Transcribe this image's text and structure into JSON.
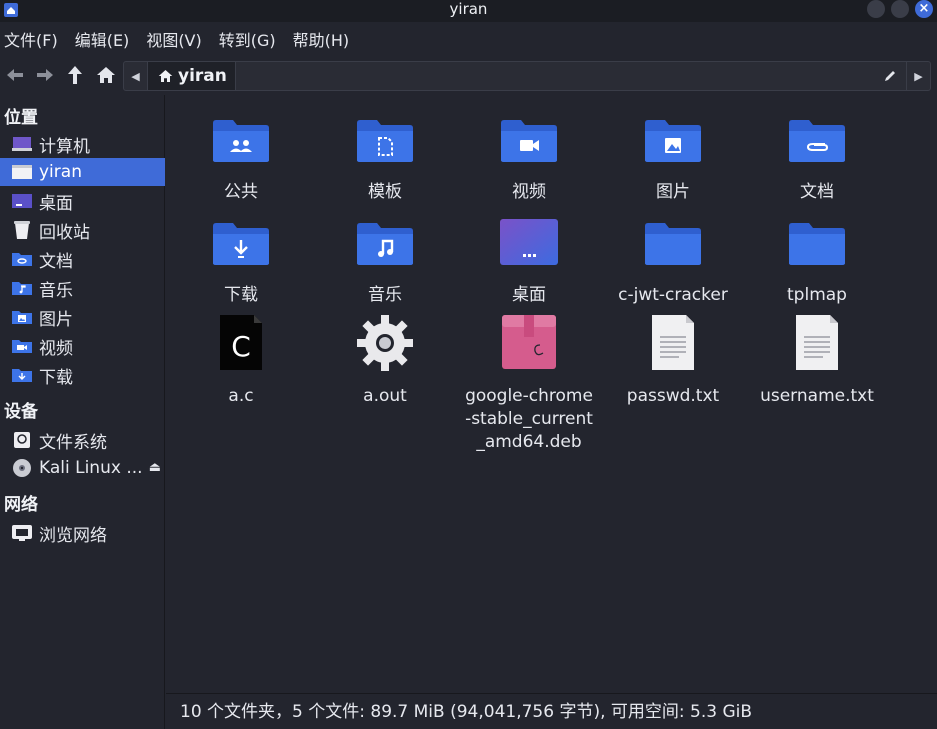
{
  "window": {
    "title": "yiran"
  },
  "menu": [
    "文件(F)",
    "编辑(E)",
    "视图(V)",
    "转到(G)",
    "帮助(H)"
  ],
  "path": {
    "current": "yiran"
  },
  "sidebar": {
    "places_heading": "位置",
    "places": [
      {
        "label": "计算机",
        "icon": "computer-icon"
      },
      {
        "label": "yiran",
        "icon": "home-folder-icon",
        "active": true
      },
      {
        "label": "桌面",
        "icon": "desktop-icon"
      },
      {
        "label": "回收站",
        "icon": "trash-icon"
      },
      {
        "label": "文档",
        "icon": "documents-folder-icon"
      },
      {
        "label": "音乐",
        "icon": "music-folder-icon"
      },
      {
        "label": "图片",
        "icon": "pictures-folder-icon"
      },
      {
        "label": "视频",
        "icon": "videos-folder-icon"
      },
      {
        "label": "下载",
        "icon": "downloads-folder-icon"
      }
    ],
    "devices_heading": "设备",
    "devices": [
      {
        "label": "文件系统",
        "icon": "drive-icon"
      },
      {
        "label": "Kali Linux ...",
        "icon": "optical-disc-icon"
      }
    ],
    "network_heading": "网络",
    "network": [
      {
        "label": "浏览网络",
        "icon": "network-icon"
      }
    ]
  },
  "files": [
    {
      "name": "公共",
      "icon": "folder-public-icon",
      "glyph": "users"
    },
    {
      "name": "模板",
      "icon": "folder-templates-icon",
      "glyph": "template"
    },
    {
      "name": "视频",
      "icon": "folder-videos-icon",
      "glyph": "video"
    },
    {
      "name": "图片",
      "icon": "folder-pictures-icon",
      "glyph": "image"
    },
    {
      "name": "文档",
      "icon": "folder-documents-icon",
      "glyph": "clip"
    },
    {
      "name": "下载",
      "icon": "folder-downloads-icon",
      "glyph": "download"
    },
    {
      "name": "音乐",
      "icon": "folder-music-icon",
      "glyph": "music"
    },
    {
      "name": "桌面",
      "icon": "desktop-icon",
      "glyph": "desktop"
    },
    {
      "name": "c-jwt-cracker",
      "icon": "folder-icon",
      "glyph": ""
    },
    {
      "name": "tplmap",
      "icon": "folder-icon",
      "glyph": ""
    },
    {
      "name": "a.c",
      "icon": "c-source-file-icon",
      "glyph": "c"
    },
    {
      "name": "a.out",
      "icon": "executable-gear-icon",
      "glyph": "gear"
    },
    {
      "name": "google-chrome-stable_current_amd64.deb",
      "icon": "debian-package-icon",
      "glyph": "deb"
    },
    {
      "name": "passwd.txt",
      "icon": "text-file-icon",
      "glyph": "text"
    },
    {
      "name": "username.txt",
      "icon": "text-file-icon",
      "glyph": "text"
    }
  ],
  "status": "10 个文件夹，5 个文件: 89.7 MiB (94,041,756 字节), 可用空间: 5.3 GiB",
  "colors": {
    "accent": "#3f6bd8",
    "folder": "#3d74e8",
    "background": "#23252e"
  }
}
